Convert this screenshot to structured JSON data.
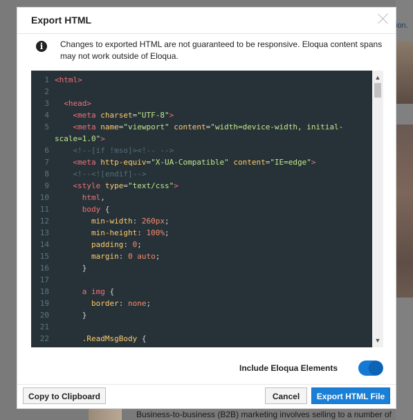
{
  "background": {
    "link_fragment": "ion.",
    "bottom_text": "Business-to-business (B2B) marketing involves selling to a number of"
  },
  "dialog": {
    "title": "Export HTML",
    "info_text": "Changes to exported HTML are not guaranteed to be responsive. Eloqua content spans may not work outside of Eloqua.",
    "toggle_label": "Include Eloqua Elements",
    "toggle_on": true,
    "buttons": {
      "copy": "Copy to Clipboard",
      "cancel": "Cancel",
      "export": "Export HTML File"
    }
  },
  "code": {
    "lines": [
      {
        "n": "1",
        "tokens": [
          [
            "tag",
            "<html>"
          ]
        ]
      },
      {
        "n": "2",
        "tokens": []
      },
      {
        "n": "3",
        "tokens": [
          [
            "punc",
            "  "
          ],
          [
            "tag",
            "<head>"
          ]
        ]
      },
      {
        "n": "4",
        "tokens": [
          [
            "punc",
            "    "
          ],
          [
            "tag",
            "<meta "
          ],
          [
            "attr",
            "charset"
          ],
          [
            "punc",
            "="
          ],
          [
            "str",
            "\"UTF-8\""
          ],
          [
            "tag",
            ">"
          ]
        ]
      },
      {
        "n": "5",
        "tokens": [
          [
            "punc",
            "    "
          ],
          [
            "tag",
            "<meta "
          ],
          [
            "attr",
            "name"
          ],
          [
            "punc",
            "="
          ],
          [
            "str",
            "\"viewport\" "
          ],
          [
            "attr",
            "content"
          ],
          [
            "punc",
            "="
          ],
          [
            "str",
            "\"width=device-width, initial-"
          ]
        ]
      },
      {
        "n": "",
        "tokens": [
          [
            "str",
            "scale=1.0\""
          ],
          [
            "tag",
            ">"
          ]
        ]
      },
      {
        "n": "6",
        "tokens": [
          [
            "punc",
            "    "
          ],
          [
            "com",
            "<!--[if !mso]><!-- -->"
          ]
        ]
      },
      {
        "n": "7",
        "tokens": [
          [
            "punc",
            "    "
          ],
          [
            "tag",
            "<meta "
          ],
          [
            "attr",
            "http-equiv"
          ],
          [
            "punc",
            "="
          ],
          [
            "str",
            "\"X-UA-Compatible\" "
          ],
          [
            "attr",
            "content"
          ],
          [
            "punc",
            "="
          ],
          [
            "str",
            "\"IE=edge\""
          ],
          [
            "tag",
            ">"
          ]
        ]
      },
      {
        "n": "8",
        "tokens": [
          [
            "punc",
            "    "
          ],
          [
            "com",
            "<!--<![endif]-->"
          ]
        ]
      },
      {
        "n": "9",
        "tokens": [
          [
            "punc",
            "    "
          ],
          [
            "tag",
            "<style "
          ],
          [
            "attr",
            "type"
          ],
          [
            "punc",
            "="
          ],
          [
            "str",
            "\"text/css\""
          ],
          [
            "tag",
            ">"
          ]
        ]
      },
      {
        "n": "10",
        "tokens": [
          [
            "punc",
            "      "
          ],
          [
            "prop",
            "html"
          ],
          [
            "punc",
            ","
          ]
        ]
      },
      {
        "n": "11",
        "tokens": [
          [
            "punc",
            "      "
          ],
          [
            "prop",
            "body"
          ],
          [
            "punc",
            " {"
          ]
        ]
      },
      {
        "n": "12",
        "tokens": [
          [
            "punc",
            "        "
          ],
          [
            "attr",
            "min-width"
          ],
          [
            "punc",
            ": "
          ],
          [
            "num",
            "260px"
          ],
          [
            "punc",
            ";"
          ]
        ]
      },
      {
        "n": "13",
        "tokens": [
          [
            "punc",
            "        "
          ],
          [
            "attr",
            "min-height"
          ],
          [
            "punc",
            ": "
          ],
          [
            "num",
            "100%"
          ],
          [
            "punc",
            ";"
          ]
        ]
      },
      {
        "n": "14",
        "tokens": [
          [
            "punc",
            "        "
          ],
          [
            "attr",
            "padding"
          ],
          [
            "punc",
            ": "
          ],
          [
            "num",
            "0"
          ],
          [
            "punc",
            ";"
          ]
        ]
      },
      {
        "n": "15",
        "tokens": [
          [
            "punc",
            "        "
          ],
          [
            "attr",
            "margin"
          ],
          [
            "punc",
            ": "
          ],
          [
            "num",
            "0 auto"
          ],
          [
            "punc",
            ";"
          ]
        ]
      },
      {
        "n": "16",
        "tokens": [
          [
            "punc",
            "      }"
          ]
        ]
      },
      {
        "n": "17",
        "tokens": []
      },
      {
        "n": "18",
        "tokens": [
          [
            "punc",
            "      "
          ],
          [
            "prop",
            "a img"
          ],
          [
            "punc",
            " {"
          ]
        ]
      },
      {
        "n": "19",
        "tokens": [
          [
            "punc",
            "        "
          ],
          [
            "attr",
            "border"
          ],
          [
            "punc",
            ": "
          ],
          [
            "num",
            "none"
          ],
          [
            "punc",
            ";"
          ]
        ]
      },
      {
        "n": "20",
        "tokens": [
          [
            "punc",
            "      }"
          ]
        ]
      },
      {
        "n": "21",
        "tokens": []
      },
      {
        "n": "22",
        "tokens": [
          [
            "punc",
            "      "
          ],
          [
            "sel",
            ".ReadMsgBody"
          ],
          [
            "punc",
            " {"
          ]
        ]
      }
    ]
  },
  "colors": {
    "editor_bg": "#263238",
    "accent": "#1a7fd6"
  }
}
